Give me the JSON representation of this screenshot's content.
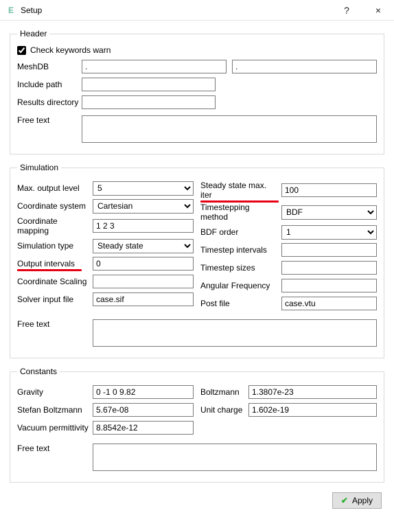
{
  "window": {
    "title": "Setup",
    "app_icon_letter": "E",
    "help_glyph": "?",
    "close_glyph": "×"
  },
  "header": {
    "legend": "Header",
    "check_keywords_label": "Check keywords warn",
    "check_keywords_checked": true,
    "meshdb_label": "MeshDB",
    "meshdb_value1": ".",
    "meshdb_value2": ".",
    "include_label": "Include path",
    "include_value": "",
    "results_label": "Results directory",
    "results_value": "",
    "freetext_label": "Free text",
    "freetext_value": ""
  },
  "sim": {
    "legend": "Simulation",
    "max_output_label": "Max. output level",
    "max_output_value": "5",
    "steady_max_label": "Steady state max. iter",
    "steady_max_value": "100",
    "coord_sys_label": "Coordinate system",
    "coord_sys_value": "Cartesian",
    "tstep_method_label": "Timestepping method",
    "tstep_method_value": "BDF",
    "coord_map_label": "Coordinate mapping",
    "coord_map_value": "1 2 3",
    "bdf_order_label": "BDF order",
    "bdf_order_value": "1",
    "sim_type_label": "Simulation type",
    "sim_type_value": "Steady state",
    "tstep_int_label": "Timestep intervals",
    "tstep_int_value": "",
    "out_int_label": "Output intervals",
    "out_int_value": "0",
    "tstep_sizes_label": "Timestep sizes",
    "tstep_sizes_value": "",
    "coord_scale_label": "Coordinate Scaling",
    "coord_scale_value": "",
    "ang_freq_label": "Angular Frequency",
    "ang_freq_value": "",
    "solver_file_label": "Solver input file",
    "solver_file_value": "case.sif",
    "post_file_label": "Post file",
    "post_file_value": "case.vtu",
    "freetext_label": "Free text",
    "freetext_value": ""
  },
  "const": {
    "legend": "Constants",
    "gravity_label": "Gravity",
    "gravity_value": "0 -1 0 9.82",
    "boltz_label": "Boltzmann",
    "boltz_value": "1.3807e-23",
    "sb_label": "Stefan Boltzmann",
    "sb_value": "5.67e-08",
    "charge_label": "Unit charge",
    "charge_value": "1.602e-19",
    "vac_label": "Vacuum permittivity",
    "vac_value": "8.8542e-12",
    "freetext_label": "Free text",
    "freetext_value": ""
  },
  "footer": {
    "apply_label": "Apply"
  }
}
